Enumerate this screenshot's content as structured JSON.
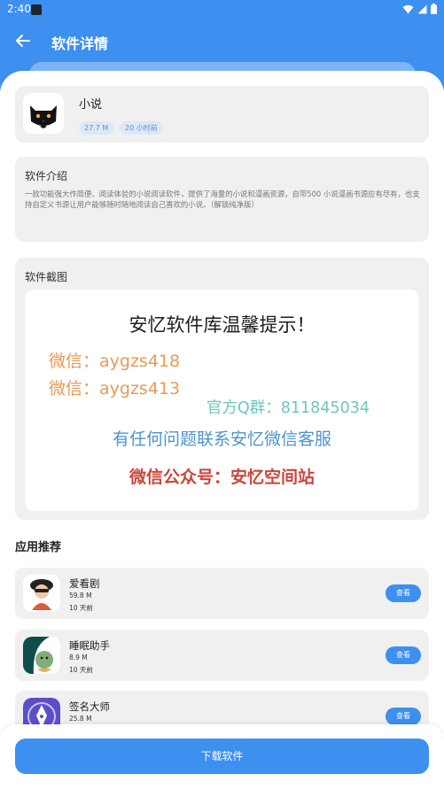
{
  "status_bar": {
    "time": "2:40"
  },
  "header": {
    "title": "软件详情"
  },
  "app": {
    "name": "小说",
    "size": "27.7 M",
    "updated": "20 小时前"
  },
  "intro": {
    "heading": "软件介绍",
    "text": "一款功能强大作简便、阅读体验的小说阅读软件，提供了海量的小说和漫画资源，自带500 小说漫画书源应有尽有，也支持自定义书源让用户能够随时随地阅读自己喜欢的小说。（解锁纯净版）"
  },
  "screenshots": {
    "heading": "软件截图",
    "image_text": {
      "title": "安忆软件库温馨提示！",
      "wechat1": "微信：aygzs418",
      "wechat2": "微信：aygzs413",
      "qq_group": "官方Q群：811845034",
      "contact": "有任何问题联系安忆微信客服",
      "official_account": "微信公众号：安忆空间站"
    }
  },
  "recommend": {
    "heading": "应用推荐",
    "view_label": "查看",
    "items": [
      {
        "name": "爱看剧",
        "size": "59.8 M",
        "time": "10 天前"
      },
      {
        "name": "睡眠助手",
        "size": "8.9 M",
        "time": "10 天前"
      },
      {
        "name": "签名大师",
        "size": "25.8 M",
        "time": ""
      }
    ]
  },
  "download": {
    "label": "下载软件"
  },
  "colors": {
    "primary": "#3d8ff0",
    "card_bg": "#f0f0f0"
  }
}
